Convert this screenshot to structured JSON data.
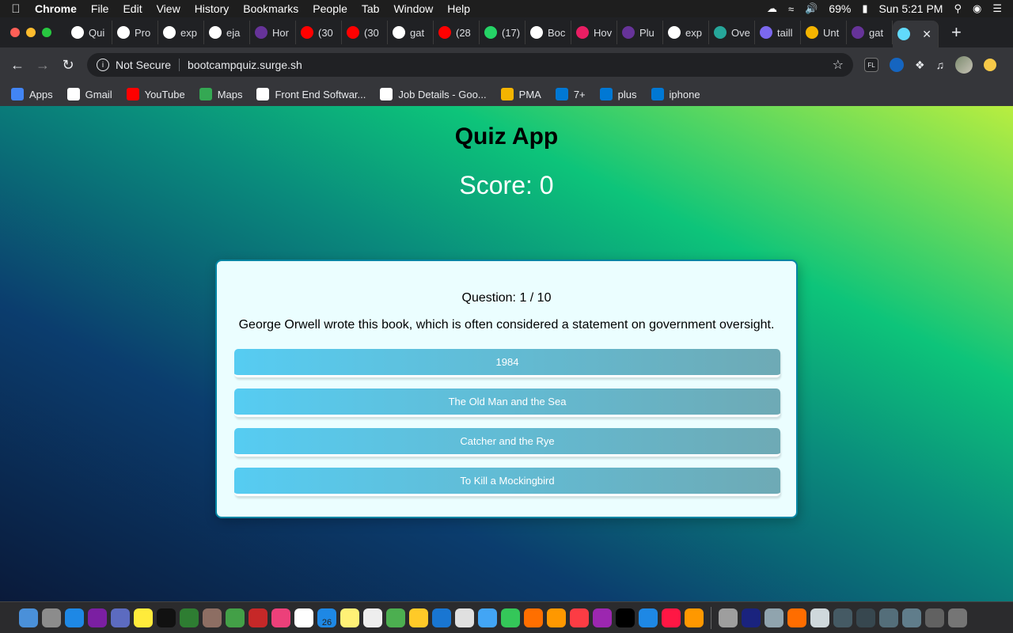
{
  "menubar": {
    "app_name": "Chrome",
    "menus": [
      "File",
      "Edit",
      "View",
      "History",
      "Bookmarks",
      "People",
      "Tab",
      "Window",
      "Help"
    ],
    "battery": "69%",
    "clock": "Sun 5:21 PM"
  },
  "tabs": [
    {
      "label": "Qui",
      "icon": "github-icon",
      "color": "#ffffff"
    },
    {
      "label": "Pro",
      "icon": "github-icon",
      "color": "#ffffff"
    },
    {
      "label": "exp",
      "icon": "github-icon",
      "color": "#ffffff"
    },
    {
      "label": "eja",
      "icon": "github-icon",
      "color": "#ffffff"
    },
    {
      "label": "Hor",
      "icon": "gatsby-icon",
      "color": "#663399"
    },
    {
      "label": "(30",
      "icon": "youtube-icon",
      "color": "#ff0000"
    },
    {
      "label": "(30",
      "icon": "youtube-icon",
      "color": "#ff0000"
    },
    {
      "label": "gat",
      "icon": "github-icon",
      "color": "#ffffff"
    },
    {
      "label": "(28",
      "icon": "youtube-icon",
      "color": "#ff0000"
    },
    {
      "label": "(17)",
      "icon": "whatsapp-icon",
      "color": "#25d366"
    },
    {
      "label": "Boc",
      "icon": "globe-icon",
      "color": "#ffffff"
    },
    {
      "label": "Hov",
      "icon": "play-icon",
      "color": "#e91e63"
    },
    {
      "label": "Plu",
      "icon": "gatsby-icon",
      "color": "#663399"
    },
    {
      "label": "exp",
      "icon": "github-icon",
      "color": "#ffffff"
    },
    {
      "label": "Ove",
      "icon": "diamond-icon",
      "color": "#26a69a"
    },
    {
      "label": "taill",
      "icon": "stack-icon",
      "color": "#7b68ee"
    },
    {
      "label": "Unt",
      "icon": "c-icon",
      "color": "#f4b400"
    },
    {
      "label": "gat",
      "icon": "gatsby-icon",
      "color": "#663399"
    },
    {
      "label": "",
      "icon": "react-icon",
      "color": "#61dafb",
      "active": true
    }
  ],
  "toolbar": {
    "security_label": "Not Secure",
    "url": "bootcampquiz.surge.sh"
  },
  "bookmarks": [
    {
      "label": "Apps",
      "icon": "apps-grid-icon"
    },
    {
      "label": "Gmail",
      "icon": "google-icon"
    },
    {
      "label": "YouTube",
      "icon": "youtube-icon"
    },
    {
      "label": "Maps",
      "icon": "maps-pin-icon"
    },
    {
      "label": "Front End Softwar...",
      "icon": "google-icon"
    },
    {
      "label": "Job Details - Goo...",
      "icon": "google-icon"
    },
    {
      "label": "PMA",
      "icon": "feather-icon"
    },
    {
      "label": "7+",
      "icon": "outlook-icon"
    },
    {
      "label": "plus",
      "icon": "outlook-icon"
    },
    {
      "label": "iphone",
      "icon": "outlook-icon"
    }
  ],
  "quiz": {
    "app_title": "Quiz App",
    "score_label": "Score: 0",
    "question_counter": "Question: 1 / 10",
    "question_text": "George Orwell wrote this book, which is often considered a statement on government oversight.",
    "answers": [
      "1984",
      "The Old Man and the Sea",
      "Catcher and the Rye",
      "To Kill a Mockingbird"
    ]
  },
  "dock": {
    "calendar_day": "26",
    "colors": [
      "#4a90d9",
      "#8c8c8c",
      "#1e88e5",
      "#7b1fa2",
      "#5c6bc0",
      "#ffeb3b",
      "#111111",
      "#2e7d32",
      "#8d6e63",
      "#43a047",
      "#c62828",
      "#ec407a",
      "#ffffff",
      "#1e88e5",
      "#fff176",
      "#eeeeee",
      "#4caf50",
      "#ffca28",
      "#1976d2",
      "#e0e0e0",
      "#42a5f5",
      "#34c759",
      "#ff6f00",
      "#ff9800",
      "#fc3c44",
      "#9c27b0",
      "#000000",
      "#1e88e5",
      "#ff1744",
      "#ff9800",
      "#9e9e9e",
      "#1a237e",
      "#90a4ae",
      "#ff6d00",
      "#cfd8dc",
      "#455a64",
      "#37474f",
      "#546e7a",
      "#607d8b",
      "#616161",
      "#757575"
    ]
  }
}
